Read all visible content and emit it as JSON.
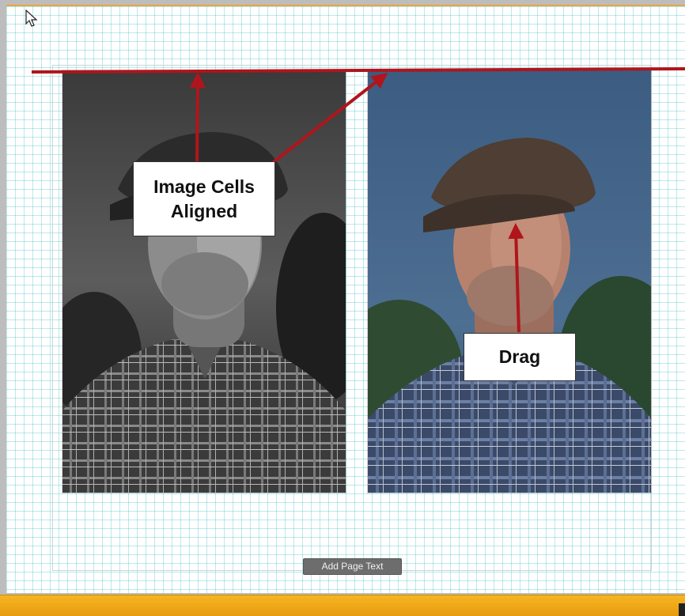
{
  "canvas": {
    "callouts": {
      "aligned": "Image Cells\nAligned",
      "drag": "Drag"
    },
    "add_page_text_button": "Add Page Text"
  },
  "colors": {
    "accent_orange": "#f0a818",
    "annotation_red": "#b0151b",
    "grid_cyan": "#40bcc4"
  },
  "icons": {
    "cursor": "arrow-cursor-icon"
  }
}
